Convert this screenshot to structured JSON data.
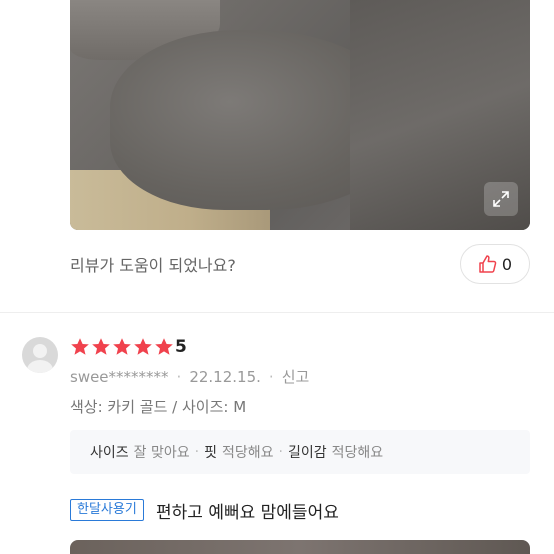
{
  "review_prev": {
    "helpful_question": "리뷰가 도움이 되었나요?",
    "like_count": "0"
  },
  "review": {
    "rating": 5,
    "rating_label": "5",
    "star_color": "#f0424d",
    "username": "swee********",
    "date": "22.12.15.",
    "report_label": "신고",
    "option_text": "색상: 카키 골드 / 사이즈: M",
    "fit": [
      {
        "key": "사이즈",
        "value": "잘 맞아요"
      },
      {
        "key": "핏",
        "value": "적당해요"
      },
      {
        "key": "길이감",
        "value": "적당해요"
      }
    ],
    "tag": "한달사용기",
    "text": "편하고 예뻐요 맘에들어요"
  },
  "icons": {
    "expand": "expand-icon",
    "like": "thumbs-up-icon",
    "avatar": "user-avatar-icon",
    "star": "star-icon"
  },
  "accent": "#2a7ad8"
}
